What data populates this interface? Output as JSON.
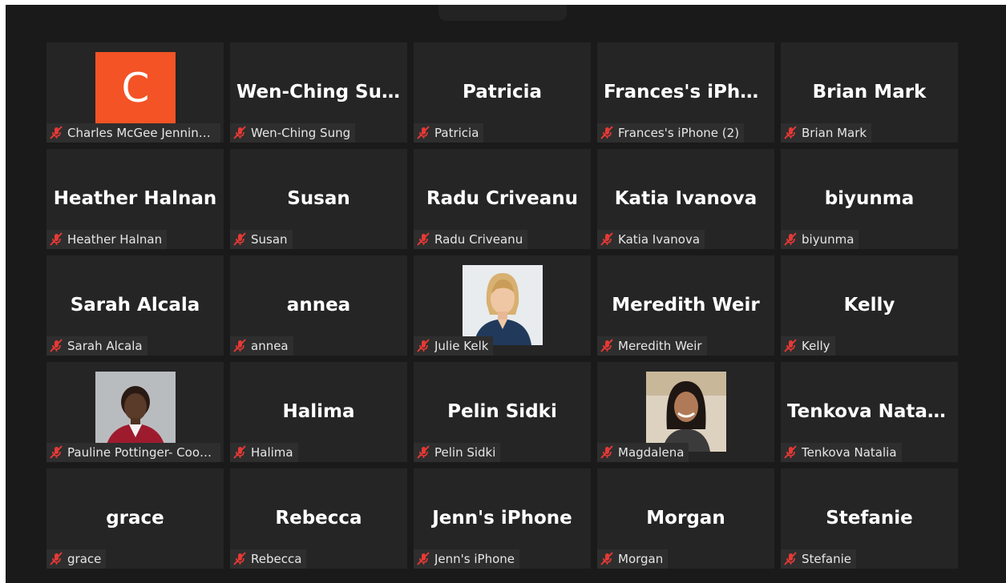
{
  "meeting": {
    "accent_color": "#f35325",
    "muted_icon_color": "#e53935",
    "participants": [
      {
        "display": "",
        "label": "Charles McGee Jennings ...",
        "avatar_letter": "C",
        "muted": true
      },
      {
        "display": "Wen-Ching Sung",
        "label": "Wen-Ching Sung",
        "muted": true
      },
      {
        "display": "Patricia",
        "label": "Patricia",
        "muted": true
      },
      {
        "display": "Frances's iPhon...",
        "label": "Frances's iPhone (2)",
        "muted": true
      },
      {
        "display": "Brian Mark",
        "label": "Brian Mark",
        "muted": true
      },
      {
        "display": "Heather Halnan",
        "label": "Heather Halnan",
        "muted": true
      },
      {
        "display": "Susan",
        "label": "Susan",
        "muted": true
      },
      {
        "display": "Radu Criveanu",
        "label": "Radu Criveanu",
        "muted": true
      },
      {
        "display": "Katia Ivanova",
        "label": "Katia Ivanova",
        "muted": true
      },
      {
        "display": "biyunma",
        "label": "biyunma",
        "muted": true
      },
      {
        "display": "Sarah Alcala",
        "label": "Sarah Alcala",
        "muted": true
      },
      {
        "display": "annea",
        "label": "annea",
        "muted": true
      },
      {
        "display": "",
        "label": "Julie Kelk",
        "photo": "blonde-woman-photo",
        "muted": true
      },
      {
        "display": "Meredith Weir",
        "label": "Meredith Weir",
        "muted": true
      },
      {
        "display": "Kelly",
        "label": "Kelly",
        "muted": true
      },
      {
        "display": "",
        "label": "Pauline Pottinger- Cooper",
        "photo": "woman-red-jacket-photo",
        "muted": true
      },
      {
        "display": "Halima",
        "label": "Halima",
        "muted": true
      },
      {
        "display": "Pelin Sidki",
        "label": "Pelin Sidki",
        "muted": true
      },
      {
        "display": "",
        "label": "Magdalena",
        "photo": "smiling-woman-photo",
        "muted": true
      },
      {
        "display": "Tenkova Natalia",
        "label": "Tenkova Natalia",
        "muted": true
      },
      {
        "display": "grace",
        "label": "grace",
        "muted": true
      },
      {
        "display": "Rebecca",
        "label": "Rebecca",
        "muted": true
      },
      {
        "display": "Jenn's iPhone",
        "label": "Jenn's iPhone",
        "muted": true
      },
      {
        "display": "Morgan",
        "label": "Morgan",
        "muted": true
      },
      {
        "display": "Stefanie",
        "label": "Stefanie",
        "muted": true
      }
    ]
  }
}
